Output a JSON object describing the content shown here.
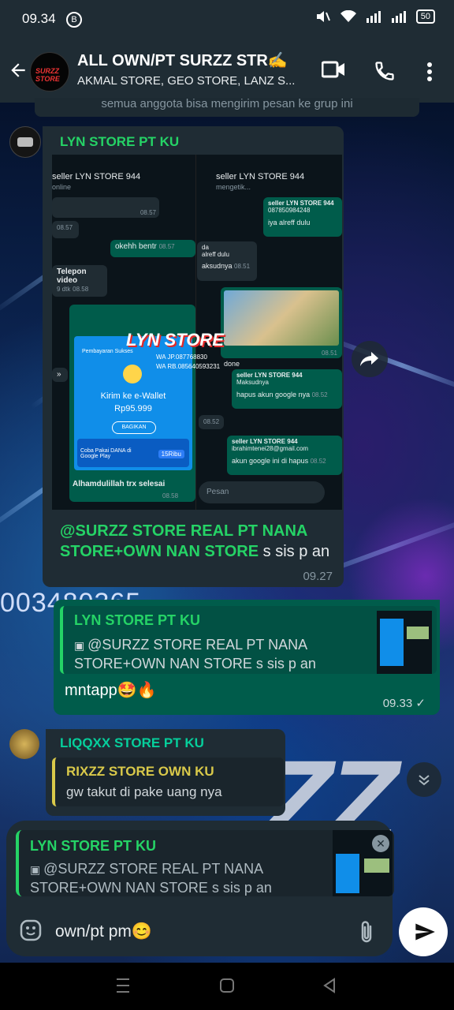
{
  "status": {
    "time": "09.34",
    "notif_badge": "B",
    "battery": "50"
  },
  "header": {
    "title": "ALL OWN/PT SURZZ STR✍",
    "subtitle": "AKMAL STORE, GEO STORE, LANZ S...",
    "avatar_text": "SURZZ STORE"
  },
  "system_notice": "semua anggota bisa mengirim pesan ke grup ini",
  "background_number": "003480365",
  "messages": [
    {
      "sender": "LYN STORE PT KU",
      "mention": "@SURZZ STORE REAL PT NANA STORE+OWN NAN STORE",
      "text": " s sis p an",
      "time": "09.27",
      "screenshot": {
        "left_header": "seller LYN STORE 944",
        "left_status": "online",
        "right_header": "seller LYN STORE 944",
        "right_status": "mengetik...",
        "items": {
          "t1": "08.57",
          "t2": "08.57",
          "okeh": "okehh bentr",
          "okeh_time": "08.57",
          "call": "Telepon video",
          "call_dur": "9 dtk",
          "call_time": "08.58",
          "reply_sender": "seller LYN STORE 944",
          "reply_phone": "087850984248",
          "iya": "iya alreff dulu",
          "iya_time": "08.51",
          "maksud_q1": "da",
          "maksud_q2": "alreff dulu",
          "maksud": "aksudnya",
          "maksud_time": "08.51",
          "watermark": "LYN STORE",
          "wa_jp": "WA JP.087768830",
          "wa_rb": "WA RB.085640593231",
          "dana_title": "Pembayaran Sukses",
          "ewallet": "Kirim ke e-Wallet",
          "amount": "Rp95.999",
          "share": "BAGIKAN",
          "promo": "Coba Pakai DANA di Google Play",
          "promo_amt": "15Ribu",
          "caption": "Alhamdulillah trx selesai",
          "caption_time": "08.58",
          "game_time": "08.51",
          "done": "done",
          "q2_sender": "seller LYN STORE 944",
          "q2_text": "Maksudnya",
          "hapus": "hapus akun google nya",
          "hapus_time": "08.52",
          "t3": "08.52",
          "q3_sender": "seller LYN STORE 944",
          "q3_text": "ibrahimtenei28@gmail.com",
          "akun": "akun google ini di hapus",
          "akun_time": "08.52",
          "pesan": "Pesan"
        }
      }
    },
    {
      "quote_sender": "LYN STORE PT KU",
      "quote_text": "@SURZZ STORE REAL PT NANA STORE+OWN NAN STORE s sis p an",
      "text": "mntapp🤩🔥",
      "time": "09.33"
    },
    {
      "sender": "LIQQXX STORE PT KU",
      "quote_sender": "RIXZZ STORE OWN KU",
      "quote_text": "gw takut di pake uang nya"
    }
  ],
  "reply_preview": {
    "sender": "LYN STORE PT KU",
    "text": "@SURZZ STORE REAL PT NANA STORE+OWN NAN STORE s sis p an"
  },
  "composer": {
    "value": "own/pt pm😊"
  },
  "colors": {
    "header": "#1f2c34",
    "outgoing": "#005c4b",
    "incoming": "#1f2c34",
    "accent": "#25d366"
  },
  "icons": [
    "back-arrow-icon",
    "video-call-icon",
    "phone-icon",
    "more-icon",
    "forward-icon",
    "scroll-down-icon",
    "emoji-icon",
    "attach-icon",
    "send-icon",
    "close-icon"
  ]
}
